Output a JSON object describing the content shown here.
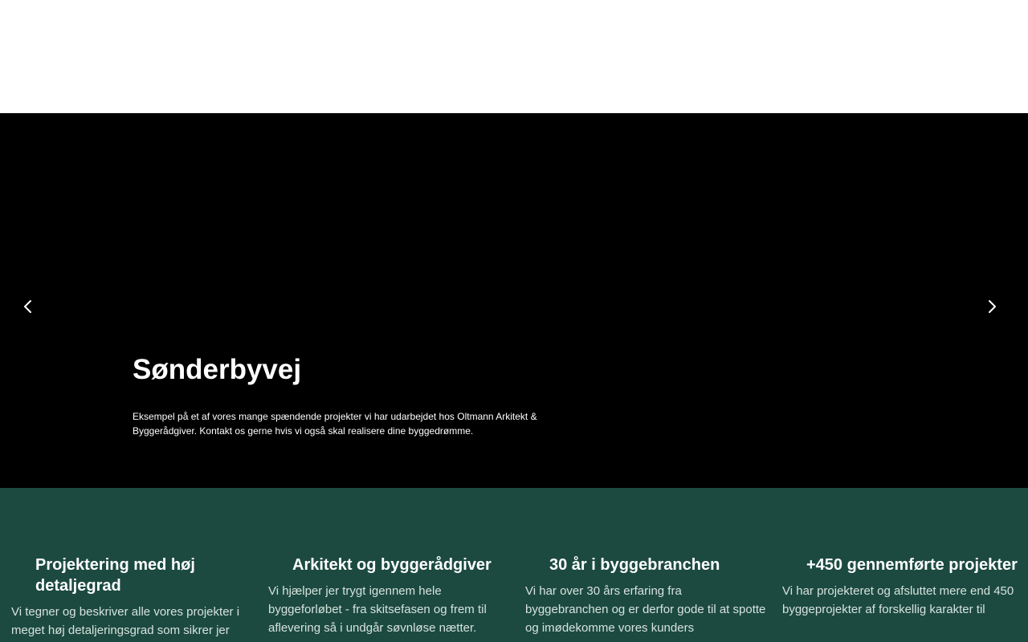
{
  "hero": {
    "title": "Sønderbyvej",
    "description": "Eksempel på et af vores mange spændende projekter vi har udarbejdet hos Oltmann Arkitekt & Byggerådgiver. Kontakt os gerne hvis vi også skal realisere dine byggedrømme.",
    "prev_icon": "chevron-left-icon",
    "next_icon": "chevron-right-icon"
  },
  "features": [
    {
      "title": "Projektering med høj detaljegrad",
      "text": "Vi tegner og beskriver alle vores projekter i meget høj detaljeringsgrad som sikrer jer"
    },
    {
      "title": "Arkitekt og byggerådgiver",
      "text": "Vi hjælper jer trygt igennem hele byggeforløbet - fra skitsefasen og frem til aflevering så i undgår søvnløse nætter."
    },
    {
      "title": "30 år i byggebranchen",
      "text": "Vi har over 30 års erfaring fra byggebranchen og er derfor gode til at spotte og imødekomme vores kunders"
    },
    {
      "title": "+450 gennemførte projekter",
      "text": "Vi har projekteret og afsluttet mere end 450 byggeprojekter af forskellig karakter til"
    }
  ],
  "colors": {
    "hero_background": "#000000",
    "features_background": "#1c4a40",
    "text": "#ffffff"
  }
}
